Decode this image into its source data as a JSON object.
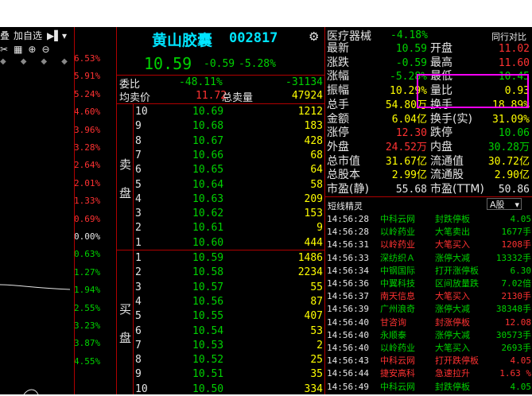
{
  "toolbar": {
    "partial_label": "叠",
    "add_watch": "加自选",
    "scale_pcts": [
      "6.53%",
      "5.91%",
      "5.24%",
      "4.60%",
      "3.96%",
      "3.28%",
      "2.64%",
      "2.01%",
      "1.33%",
      "0.69%",
      "0.00%",
      "0.63%",
      "1.27%",
      "1.94%",
      "2.55%",
      "3.23%",
      "3.87%",
      "4.55%"
    ]
  },
  "header": {
    "name": "黄山胶囊",
    "code": "002817",
    "price": "10.59",
    "change": "-0.59",
    "change_pct": "-5.28%"
  },
  "weibi": {
    "label": "委比",
    "pct": "-48.11%",
    "diff": "-31134"
  },
  "avg_sell": {
    "label": "均卖价",
    "price": "11.72",
    "total_label": "总卖量",
    "total": "47924"
  },
  "sell": {
    "label1": "卖",
    "label2": "盘",
    "levels": [
      {
        "lvl": "10",
        "price": "10.69",
        "vol": "1212"
      },
      {
        "lvl": "9",
        "price": "10.68",
        "vol": "183"
      },
      {
        "lvl": "8",
        "price": "10.67",
        "vol": "428"
      },
      {
        "lvl": "7",
        "price": "10.66",
        "vol": "68"
      },
      {
        "lvl": "6",
        "price": "10.65",
        "vol": "64"
      },
      {
        "lvl": "5",
        "price": "10.64",
        "vol": "58"
      },
      {
        "lvl": "4",
        "price": "10.63",
        "vol": "209"
      },
      {
        "lvl": "3",
        "price": "10.62",
        "vol": "153"
      },
      {
        "lvl": "2",
        "price": "10.61",
        "vol": "9"
      },
      {
        "lvl": "1",
        "price": "10.60",
        "vol": "444"
      }
    ]
  },
  "buy": {
    "label1": "买",
    "label2": "盘",
    "levels": [
      {
        "lvl": "1",
        "price": "10.59",
        "vol": "1486"
      },
      {
        "lvl": "2",
        "price": "10.58",
        "vol": "2234"
      },
      {
        "lvl": "3",
        "price": "10.57",
        "vol": "55"
      },
      {
        "lvl": "4",
        "price": "10.56",
        "vol": "87"
      },
      {
        "lvl": "5",
        "price": "10.55",
        "vol": "407"
      },
      {
        "lvl": "6",
        "price": "10.54",
        "vol": "53"
      },
      {
        "lvl": "7",
        "price": "10.53",
        "vol": "2"
      },
      {
        "lvl": "8",
        "price": "10.52",
        "vol": "25"
      },
      {
        "lvl": "9",
        "price": "10.51",
        "vol": "35"
      },
      {
        "lvl": "10",
        "price": "10.50",
        "vol": "334"
      }
    ]
  },
  "sector": {
    "name": "医疗器械",
    "pct": "-4.18%",
    "compare": "同行对比"
  },
  "quote": [
    {
      "l1": "最新",
      "v1": "10.59",
      "c1": "green",
      "l2": "开盘",
      "v2": "11.02",
      "c2": "red"
    },
    {
      "l1": "涨跌",
      "v1": "-0.59",
      "c1": "green",
      "l2": "最高",
      "v2": "11.60",
      "c2": "red"
    },
    {
      "l1": "涨幅",
      "v1": "-5.28%",
      "c1": "green",
      "l2": "最低",
      "v2": "10.45",
      "c2": "green"
    },
    {
      "l1": "振幅",
      "v1": "10.29%",
      "c1": "yellow",
      "l2": "量比",
      "v2": "0.93",
      "c2": "yellow"
    },
    {
      "l1": "总手",
      "v1": "54.80万",
      "c1": "yellow",
      "l2": "换手",
      "v2": "18.89%",
      "c2": "yellow"
    },
    {
      "l1": "金额",
      "v1": "6.04亿",
      "c1": "yellow",
      "l2": "换手(实)",
      "v2": "31.09%",
      "c2": "yellow"
    },
    {
      "l1": "涨停",
      "v1": "12.30",
      "c1": "red",
      "l2": "跌停",
      "v2": "10.06",
      "c2": "green"
    },
    {
      "l1": "外盘",
      "v1": "24.52万",
      "c1": "red",
      "l2": "内盘",
      "v2": "30.28万",
      "c2": "green"
    },
    {
      "l1": "总市值",
      "v1": "31.67亿",
      "c1": "yellow",
      "l2": "流通值",
      "v2": "30.72亿",
      "c2": "yellow"
    },
    {
      "l1": "总股本",
      "v1": "2.99亿",
      "c1": "yellow",
      "l2": "流通股",
      "v2": "2.90亿",
      "c2": "yellow"
    },
    {
      "l1": "市盈(静)",
      "v1": "55.68",
      "c1": "white",
      "l2": "市盈(TTM)",
      "v2": "50.86",
      "c2": "white"
    }
  ],
  "elves": {
    "title": "短线精灵",
    "market": "A股",
    "rows": [
      {
        "time": "14:56:28",
        "stock": "中科云网",
        "event": "封跌停板",
        "val": "4.05",
        "sc": "green",
        "ec": "green"
      },
      {
        "time": "14:56:28",
        "stock": "以岭药业",
        "event": "大笔卖出",
        "val": "1677手",
        "sc": "green",
        "ec": "green"
      },
      {
        "time": "14:56:31",
        "stock": "以岭药业",
        "event": "大笔买入",
        "val": "1208手",
        "sc": "red",
        "ec": "red"
      },
      {
        "time": "14:56:33",
        "stock": "深纺织Ａ",
        "event": "涨停大减",
        "val": "13332手",
        "sc": "green",
        "ec": "green"
      },
      {
        "time": "14:56:34",
        "stock": "中钢国际",
        "event": "打开涨停板",
        "val": "6.30",
        "sc": "green",
        "ec": "green"
      },
      {
        "time": "14:56:36",
        "stock": "中翼科技",
        "event": "区间放量跌",
        "val": "7.02倍",
        "sc": "green",
        "ec": "green"
      },
      {
        "time": "14:56:37",
        "stock": "南天信息",
        "event": "大笔买入",
        "val": "2130手",
        "sc": "red",
        "ec": "red"
      },
      {
        "time": "14:56:39",
        "stock": "广州浪奇",
        "event": "涨停大减",
        "val": "38348手",
        "sc": "green",
        "ec": "green"
      },
      {
        "time": "14:56:40",
        "stock": "甘咨询",
        "event": "封涨停板",
        "val": "12.08",
        "sc": "red",
        "ec": "red"
      },
      {
        "time": "14:56:40",
        "stock": "永顺泰",
        "event": "涨停大减",
        "val": "30573手",
        "sc": "green",
        "ec": "green"
      },
      {
        "time": "14:56:40",
        "stock": "以岭药业",
        "event": "大笔买入",
        "val": "2693手",
        "sc": "green",
        "ec": "green"
      },
      {
        "time": "14:56:43",
        "stock": "中科云网",
        "event": "打开跌停板",
        "val": "4.05",
        "sc": "red",
        "ec": "red"
      },
      {
        "time": "14:56:44",
        "stock": "捷安高科",
        "event": "急速拉升",
        "val": "1.63 %",
        "sc": "red",
        "ec": "red"
      },
      {
        "time": "14:56:49",
        "stock": "中科云网",
        "event": "封跌停板",
        "val": "4.05",
        "sc": "green",
        "ec": "green"
      }
    ]
  },
  "colors": {
    "up": "#ff3232",
    "down": "#00d200",
    "neutral": "#e6e6e6",
    "highlight": "#ff00ff"
  }
}
